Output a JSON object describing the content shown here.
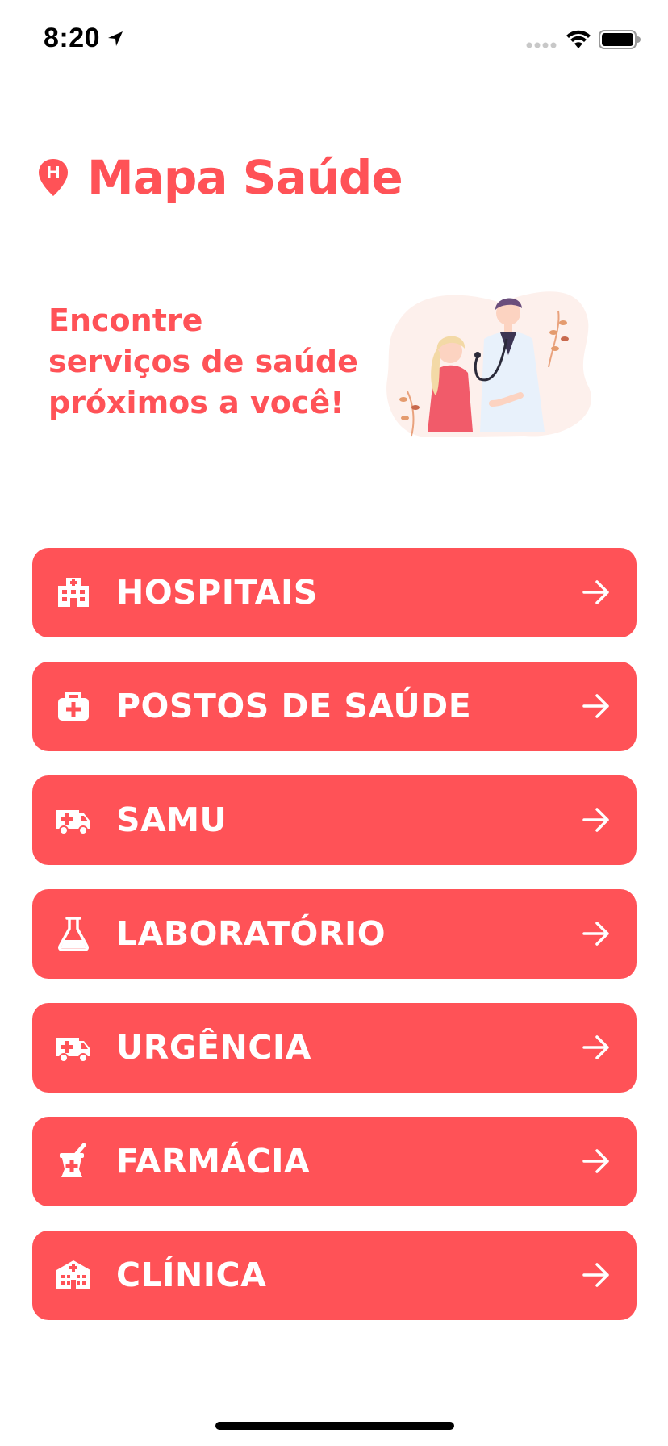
{
  "status_bar": {
    "time": "8:20"
  },
  "header": {
    "title": "Mapa Saúde",
    "icon": "hospital-pin-icon"
  },
  "hero": {
    "lines": [
      "Encontre",
      "serviços de saúde",
      "próximos a você!"
    ],
    "illustration": "doctor-patient-illustration"
  },
  "menu": [
    {
      "label": "HOSPITAIS",
      "icon": "hospital-building-icon"
    },
    {
      "label": "POSTOS DE SAÚDE",
      "icon": "medical-kit-icon"
    },
    {
      "label": "SAMU",
      "icon": "ambulance-icon"
    },
    {
      "label": "LABORATÓRIO",
      "icon": "flask-icon"
    },
    {
      "label": "URGÊNCIA",
      "icon": "ambulance-icon"
    },
    {
      "label": "FARMÁCIA",
      "icon": "mortar-pestle-icon"
    },
    {
      "label": "CLÍNICA",
      "icon": "clinic-building-icon"
    }
  ],
  "colors": {
    "accent": "#ff5257",
    "button_text": "#ffffff"
  }
}
